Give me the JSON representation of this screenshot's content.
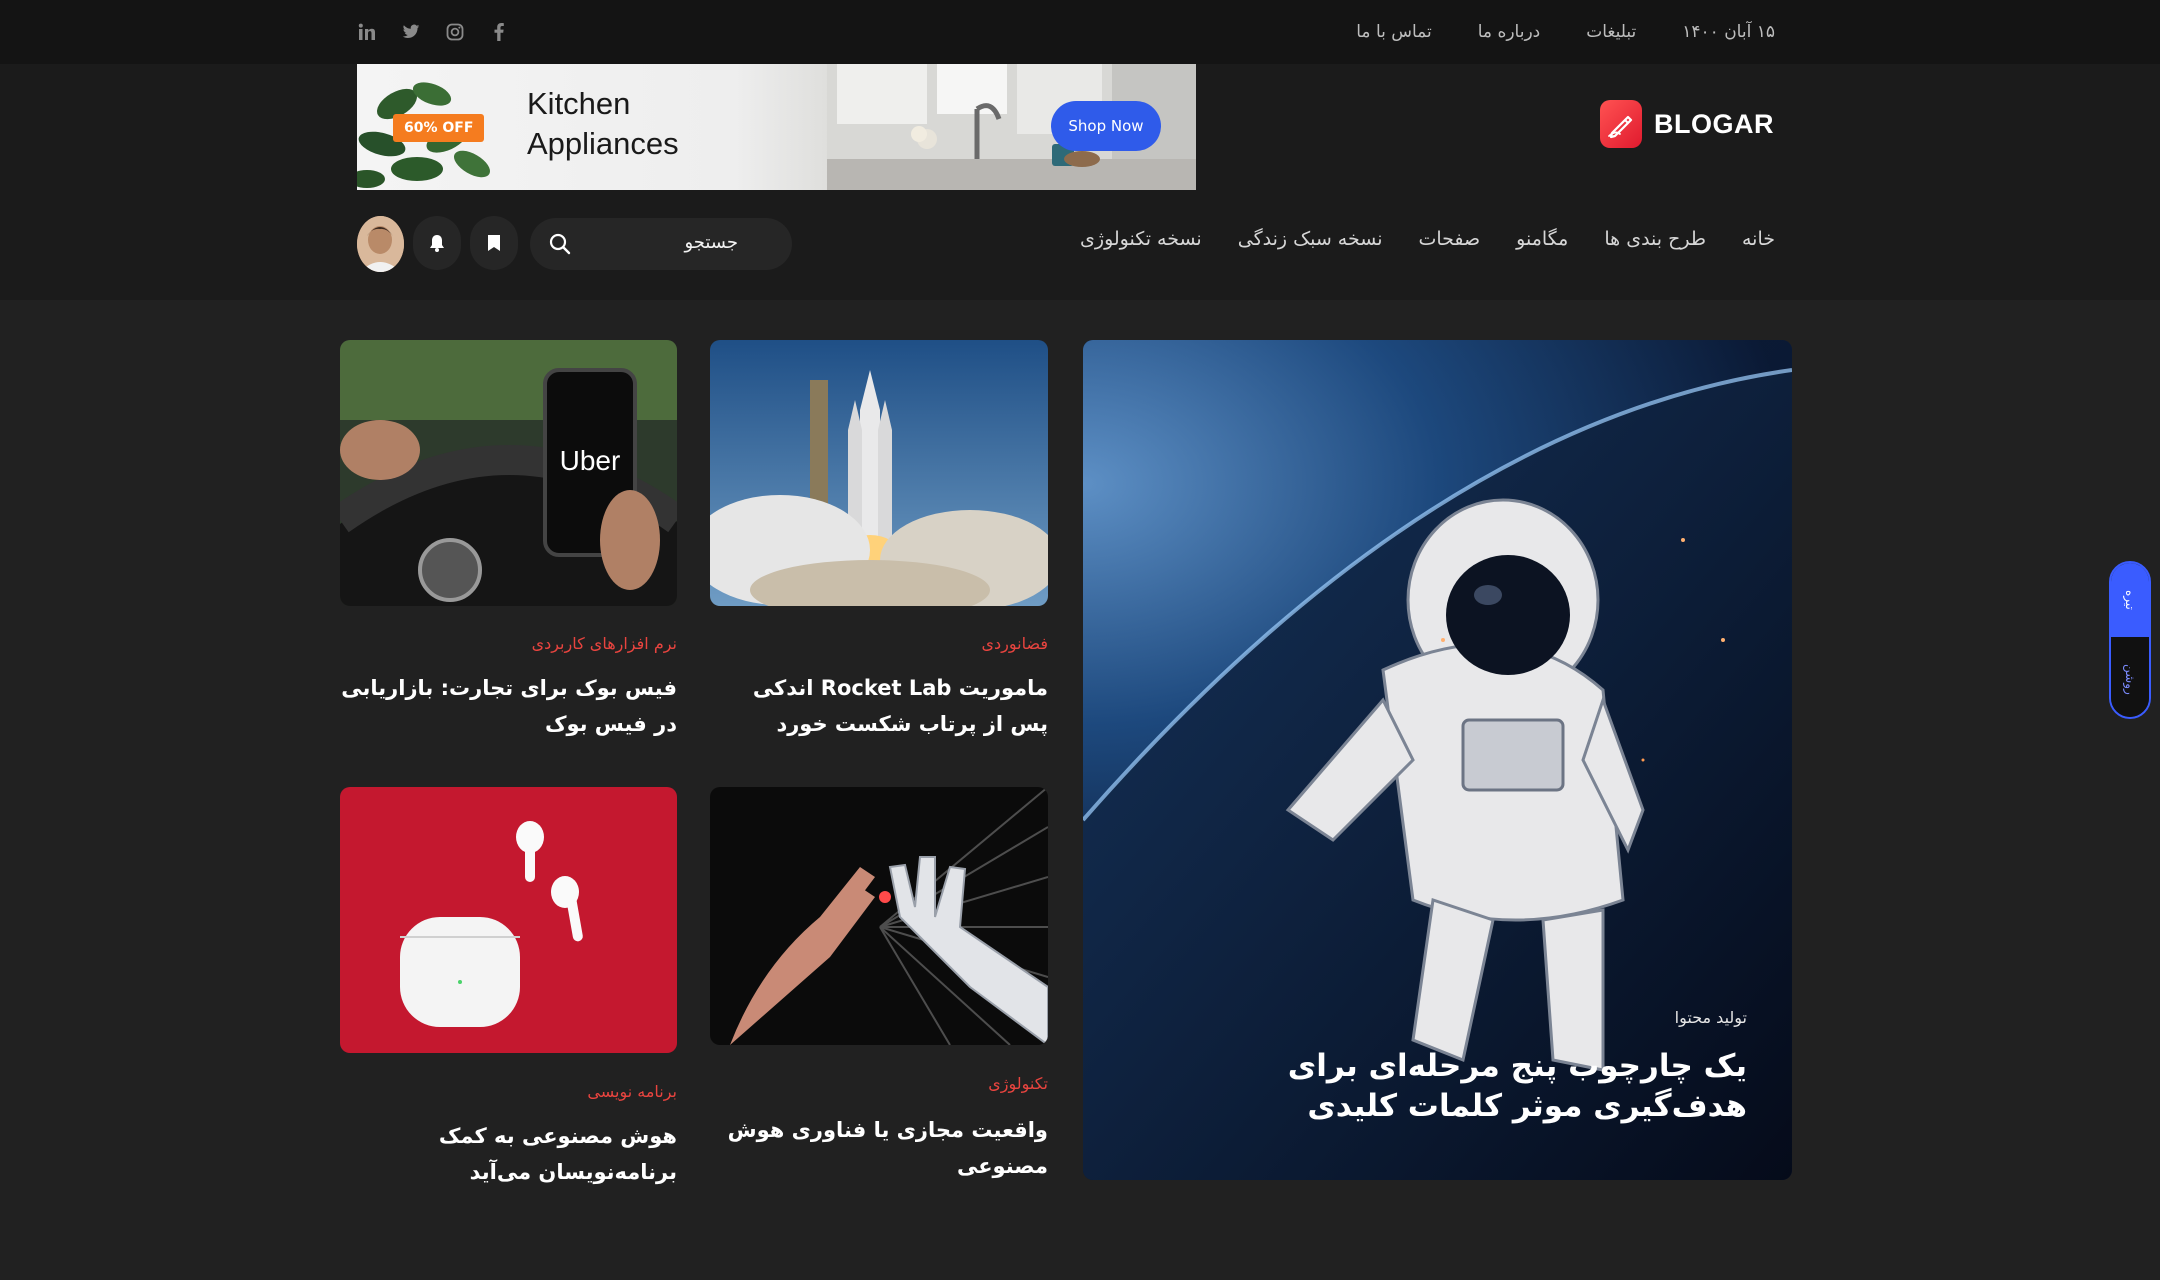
{
  "topbar": {
    "date": "۱۵ آبان ۱۴۰۰",
    "links": [
      "تبلیغات",
      "درباره ما",
      "تماس با ما"
    ],
    "social_icons": [
      "facebook-icon",
      "instagram-icon",
      "twitter-icon",
      "linkedin-icon"
    ]
  },
  "logo": {
    "text": "BLOGAR"
  },
  "banner": {
    "offer": "60% OFF",
    "title_line1": "Kitchen",
    "title_line2": "Appliances",
    "button": "Shop Now"
  },
  "mainnav": {
    "items": [
      "خانه",
      "طرح بندی ها",
      "مگامنو",
      "صفحات",
      "نسخه سبک زندگی",
      "نسخه تکنولوژی"
    ]
  },
  "search": {
    "placeholder": "جستجو"
  },
  "featured": {
    "category": "تولید محتوا",
    "title": "یک چارچوب پنج مرحله‌ای برای هدف‌گیری موثر کلمات کلیدی"
  },
  "posts": [
    {
      "category": "فضانوردی",
      "title": "ماموریت Rocket Lab اندکی پس از پرتاب شکست خورد"
    },
    {
      "category": "نرم افزارهای کاربردی",
      "title": "فیس بوک برای تجارت: بازاریابی در فیس بوک"
    },
    {
      "category": "تکنولوژی",
      "title": "واقعیت مجازی یا فناوری هوش مصنوعی"
    },
    {
      "category": "برنامه نویسی",
      "title": "هوش مصنوعی به کمک برنامه‌نویسان می‌آید"
    }
  ],
  "theme_toggle": {
    "active": "تیره",
    "inactive": "روشن"
  },
  "colors": {
    "accent": "#e8443f",
    "primary": "#2f5bea",
    "background": "#212121"
  }
}
